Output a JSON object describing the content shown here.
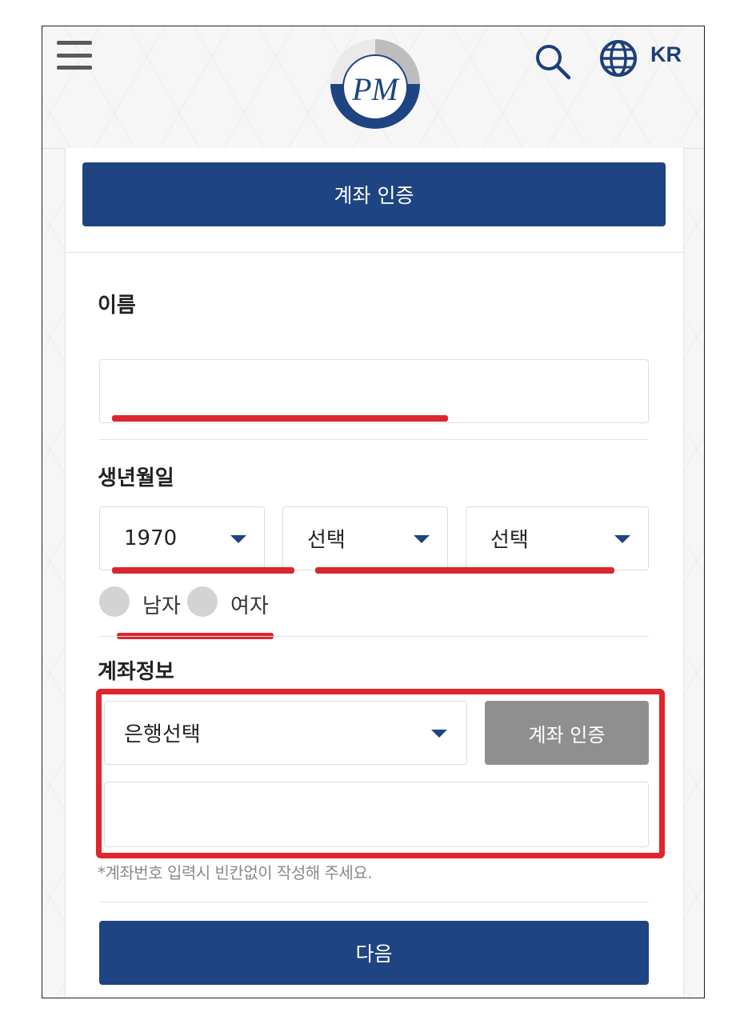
{
  "header": {
    "lang": "KR",
    "logo_text": "PM"
  },
  "page": {
    "top_button": "계좌 인증"
  },
  "name_section": {
    "label": "이름",
    "value": ""
  },
  "birth_section": {
    "label": "생년월일",
    "year": "1970",
    "month": "선택",
    "day": "선택"
  },
  "gender": {
    "options": [
      "남자",
      "여자"
    ]
  },
  "account_section": {
    "label": "계좌정보",
    "bank_select": "은행선택",
    "verify_button": "계좌 인증",
    "account_number": "",
    "hint": "*계좌번호 입력시 빈칸없이 작성해 주세요."
  },
  "next_button": "다음",
  "colors": {
    "primary": "#1e4482",
    "disabled": "#8f8f8f",
    "highlight": "#e0252b"
  }
}
